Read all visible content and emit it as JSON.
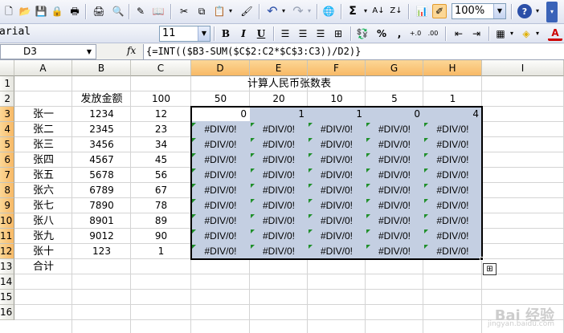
{
  "toolbar": {
    "zoom": "100%",
    "font_name": "arial",
    "font_size": "11",
    "bold": "B",
    "italic": "I",
    "underline": "U",
    "sum_symbol": "Σ",
    "percent": "%",
    "comma": ","
  },
  "formula_bar": {
    "cell_ref": "D3",
    "fx": "fx",
    "formula": "{=INT(($B3-SUM($C$2:C2*$C$3:C3))/D2)}"
  },
  "columns": [
    "A",
    "B",
    "C",
    "D",
    "E",
    "F",
    "G",
    "H",
    "I"
  ],
  "rows": [
    "1",
    "2",
    "3",
    "4",
    "5",
    "6",
    "7",
    "8",
    "9",
    "10",
    "11",
    "12",
    "13",
    "14",
    "15",
    "16"
  ],
  "sheet": {
    "title": "计算人民币张数表",
    "header_label": "发放金额",
    "denominations": [
      "100",
      "50",
      "20",
      "10",
      "5",
      "1"
    ],
    "total_label": "合计",
    "people": [
      {
        "name": "张一",
        "amount": "1234",
        "c": "12"
      },
      {
        "name": "张二",
        "amount": "2345",
        "c": "23"
      },
      {
        "name": "张三",
        "amount": "3456",
        "c": "34"
      },
      {
        "name": "张四",
        "amount": "4567",
        "c": "45"
      },
      {
        "name": "张五",
        "amount": "5678",
        "c": "56"
      },
      {
        "name": "张六",
        "amount": "6789",
        "c": "67"
      },
      {
        "name": "张七",
        "amount": "7890",
        "c": "78"
      },
      {
        "name": "张八",
        "amount": "8901",
        "c": "89"
      },
      {
        "name": "张九",
        "amount": "9012",
        "c": "90"
      },
      {
        "name": "张十",
        "amount": "123",
        "c": "1"
      }
    ],
    "row3_results": [
      "0",
      "1",
      "1",
      "0",
      "4"
    ],
    "error_value": "#DIV/0!"
  },
  "watermark": {
    "text": "Bai 经验",
    "sub": "jingyan.baidu.com"
  },
  "colors": {
    "selection": "#c4cfe2",
    "header_selected": "#f8b966",
    "error_triangle": "#1f8f2a"
  }
}
